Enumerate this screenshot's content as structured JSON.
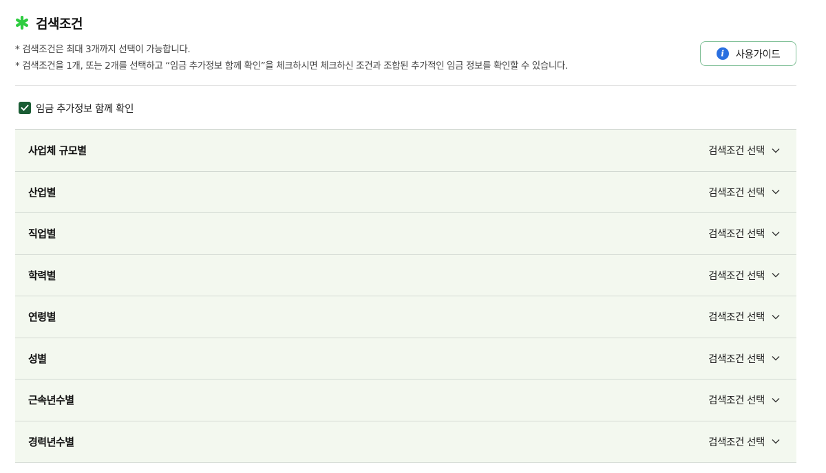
{
  "header": {
    "title": "검색조건",
    "title_icon": "asterisk-icon",
    "accent_color": "#2ecc40"
  },
  "notes": [
    "* 검색조건은 최대 3개까지 선택이 가능합니다.",
    "* 검색조건을 1개, 또는 2개를 선택하고 “임금 추가정보 함께 확인”을 체크하시면 체크하신 조건과 조합된 추가적인 임금 정보를 확인할 수 있습니다."
  ],
  "guide_button": {
    "label": "사용가이드",
    "icon": "info-icon",
    "icon_color": "#2a6fe0"
  },
  "extra_info_checkbox": {
    "label": "임금 추가정보 함께 확인",
    "checked": true,
    "color": "#1a5c34"
  },
  "conditions": [
    {
      "label": "사업체 규모별",
      "select_label": "검색조건 선택"
    },
    {
      "label": "산업별",
      "select_label": "검색조건 선택"
    },
    {
      "label": "직업별",
      "select_label": "검색조건 선택"
    },
    {
      "label": "학력별",
      "select_label": "검색조건 선택"
    },
    {
      "label": "연령별",
      "select_label": "검색조건 선택"
    },
    {
      "label": "성별",
      "select_label": "검색조건 선택"
    },
    {
      "label": "근속년수별",
      "select_label": "검색조건 선택"
    },
    {
      "label": "경력년수별",
      "select_label": "검색조건 선택"
    }
  ]
}
